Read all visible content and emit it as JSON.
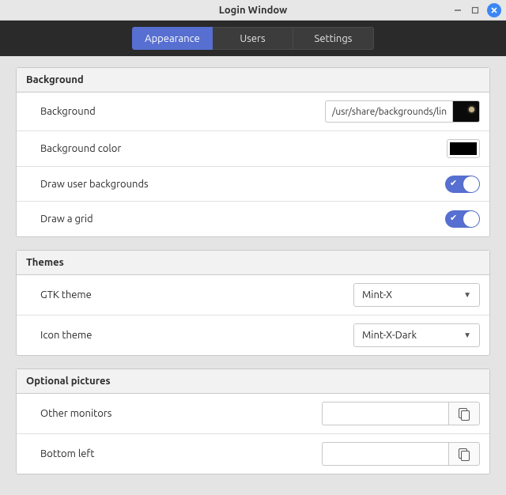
{
  "window": {
    "title": "Login Window"
  },
  "tabs": {
    "appearance": "Appearance",
    "users": "Users",
    "settings": "Settings",
    "active": "appearance"
  },
  "groups": {
    "background": {
      "title": "Background",
      "rows": {
        "bg": {
          "label": "Background",
          "path": "/usr/share/backgrounds/lin"
        },
        "color": {
          "label": "Background color",
          "value": "#000000"
        },
        "draw_user": {
          "label": "Draw user backgrounds",
          "on": true
        },
        "grid": {
          "label": "Draw a grid",
          "on": true
        }
      }
    },
    "themes": {
      "title": "Themes",
      "rows": {
        "gtk": {
          "label": "GTK theme",
          "value": "Mint-X"
        },
        "icon": {
          "label": "Icon theme",
          "value": "Mint-X-Dark"
        }
      }
    },
    "optional": {
      "title": "Optional pictures",
      "rows": {
        "other": {
          "label": "Other monitors",
          "value": ""
        },
        "bottom": {
          "label": "Bottom left",
          "value": ""
        }
      }
    }
  }
}
